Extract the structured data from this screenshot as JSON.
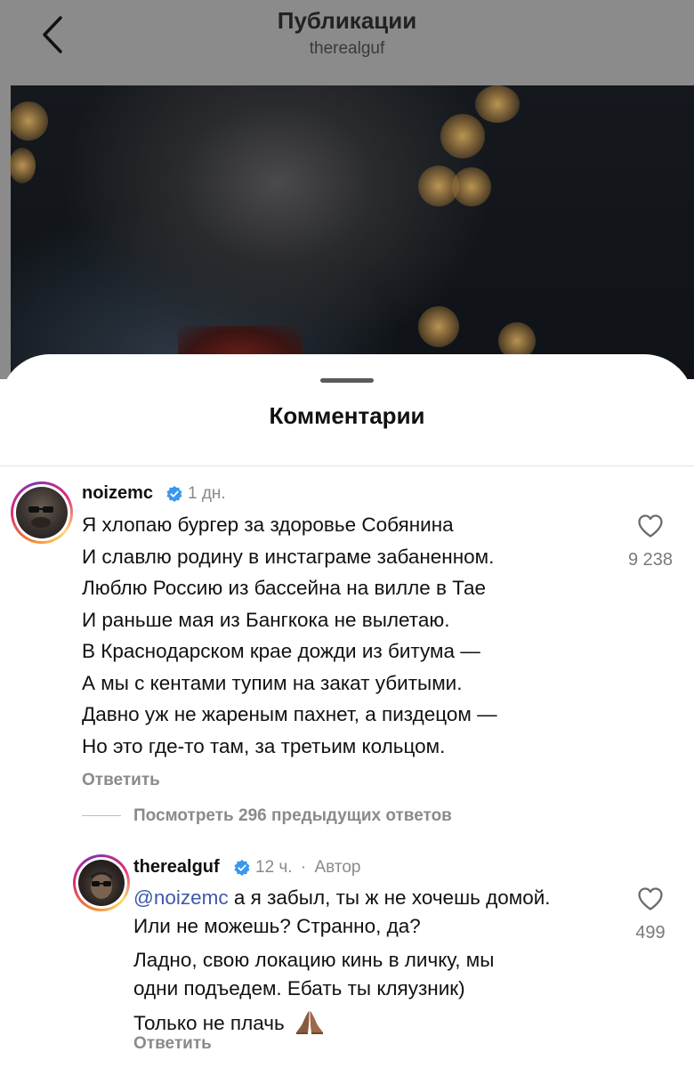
{
  "header": {
    "title": "Публикации",
    "subtitle": "therealguf"
  },
  "sheet": {
    "title": "Комментарии"
  },
  "comments": [
    {
      "username": "noizemc",
      "verified": true,
      "time": "1 дн.",
      "lines": [
        "Я хлопаю бургер за здоровье Собянина",
        "И славлю родину в инстаграме забаненном.",
        "Люблю Россию из бассейна на вилле в Тае",
        "И раньше мая из Бангкока не вылетаю.",
        "В Краснодарском крае дожди из битума —",
        "А мы с кентами тупим на закат убитыми.",
        "Давно уж не жареным пахнет, а пиздецом —",
        "Но это где-то там, за третьим кольцом."
      ],
      "reply_label": "Ответить",
      "likes": "9 238"
    }
  ],
  "view_replies_label": "Посмотреть 296 предыдущих ответов",
  "reply": {
    "username": "therealguf",
    "verified": true,
    "time": "12 ч.",
    "separator": "·",
    "author_badge": "Автор",
    "mention": "@noizemc",
    "line1_rest": " а я забыл, ты ж не хочешь домой.",
    "line2": "Или не можешь? Странно, да?",
    "line3": "Ладно, свою локацию кинь в личку, мы",
    "line4": "одни подъедем. Ебать ты кляузник)",
    "line5": "Только не плачь",
    "emoji_name": "folded-hands-emoji",
    "reply_label": "Ответить",
    "likes": "499"
  },
  "colors": {
    "header_bg": "#8b8b8b",
    "mention": "#3d5aa8",
    "verified": "#3897f0",
    "muted": "#8a8a8a"
  },
  "icons": {
    "back": "chevron-left-icon",
    "like": "heart-outline-icon",
    "verified": "verified-badge-icon"
  }
}
